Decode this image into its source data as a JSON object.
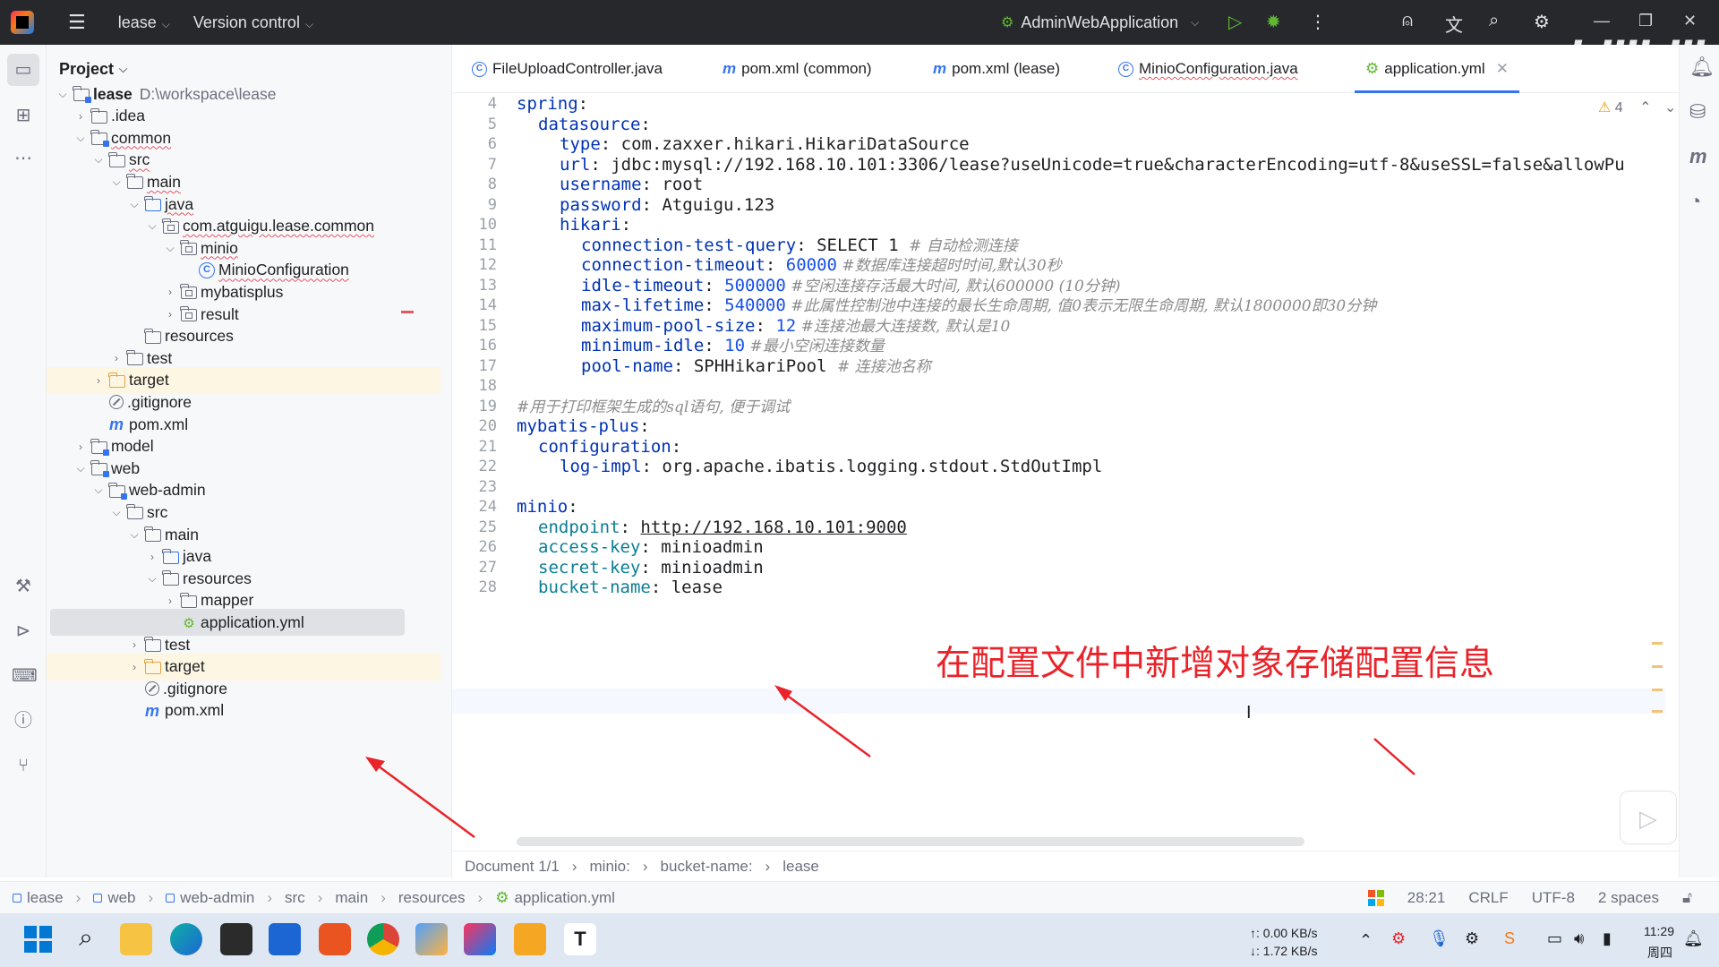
{
  "titlebar": {
    "project": "lease",
    "version_control": "Version control",
    "run_config": "AdminWebApplication"
  },
  "project_panel": {
    "title": "Project",
    "tree": [
      {
        "label": "lease",
        "path": "D:\\workspace\\lease"
      },
      {
        "label": ".idea"
      },
      {
        "label": "common"
      },
      {
        "label": "src"
      },
      {
        "label": "main"
      },
      {
        "label": "java"
      },
      {
        "label": "com.atguigu.lease.common"
      },
      {
        "label": "minio"
      },
      {
        "label": "MinioConfiguration"
      },
      {
        "label": "mybatisplus"
      },
      {
        "label": "result"
      },
      {
        "label": "resources"
      },
      {
        "label": "test"
      },
      {
        "label": "target"
      },
      {
        "label": ".gitignore"
      },
      {
        "label": "pom.xml"
      },
      {
        "label": "model"
      },
      {
        "label": "web"
      },
      {
        "label": "web-admin"
      },
      {
        "label": "src"
      },
      {
        "label": "main"
      },
      {
        "label": "java"
      },
      {
        "label": "resources"
      },
      {
        "label": "mapper"
      },
      {
        "label": "application.yml"
      },
      {
        "label": "test"
      },
      {
        "label": "target"
      },
      {
        "label": ".gitignore"
      },
      {
        "label": "pom.xml"
      }
    ]
  },
  "tabs": [
    {
      "label": "FileUploadController.java"
    },
    {
      "label": "pom.xml (common)"
    },
    {
      "label": "pom.xml (lease)"
    },
    {
      "label": "MinioConfiguration.java"
    },
    {
      "label": "application.yml"
    }
  ],
  "editor": {
    "warning_count": "4",
    "lines": [
      {
        "n": "4",
        "key": "spring",
        "rest": ":"
      },
      {
        "n": "5",
        "key": "datasource",
        "rest": ":"
      },
      {
        "n": "6",
        "key": "type",
        "rest": ": com.zaxxer.hikari.HikariDataSource"
      },
      {
        "n": "7",
        "key": "url",
        "rest": ": jdbc:mysql://192.168.10.101:3306/lease?useUnicode=true&characterEncoding=utf-8&useSSL=false&allowPu"
      },
      {
        "n": "8",
        "key": "username",
        "rest": ": root"
      },
      {
        "n": "9",
        "key": "password",
        "rest": ": Atguigu.123"
      },
      {
        "n": "10",
        "key": "hikari",
        "rest": ":"
      },
      {
        "n": "11",
        "key": "connection-test-query",
        "rest": ": SELECT 1 ",
        "comment": "# 自动检测连接"
      },
      {
        "n": "12",
        "key": "connection-timeout",
        "rest": ": ",
        "num": "60000",
        "comment": " #数据库连接超时时间,默认30秒"
      },
      {
        "n": "13",
        "key": "idle-timeout",
        "rest": ": ",
        "num": "500000",
        "comment": " #空闲连接存活最大时间, 默认600000 (10分钟)"
      },
      {
        "n": "14",
        "key": "max-lifetime",
        "rest": ": ",
        "num": "540000",
        "comment": " #此属性控制池中连接的最长生命周期, 值0表示无限生命周期, 默认1800000即30分钟"
      },
      {
        "n": "15",
        "key": "maximum-pool-size",
        "rest": ": ",
        "num": "12",
        "comment": " #连接池最大连接数, 默认是10"
      },
      {
        "n": "16",
        "key": "minimum-idle",
        "rest": ": ",
        "num": "10",
        "comment": " #最小空闲连接数量"
      },
      {
        "n": "17",
        "key": "pool-name",
        "rest": ": SPHHikariPool ",
        "comment": "# 连接池名称"
      },
      {
        "n": "18",
        "key": "",
        "rest": ""
      },
      {
        "n": "19",
        "key": "",
        "rest": "",
        "comment": "#用于打印框架生成的sql语句, 便于调试"
      },
      {
        "n": "20",
        "key": "mybatis-plus",
        "rest": ":"
      },
      {
        "n": "21",
        "key": "configuration",
        "rest": ":"
      },
      {
        "n": "22",
        "key": "log-impl",
        "rest": ": org.apache.ibatis.logging.stdout.StdOutImpl"
      },
      {
        "n": "23",
        "key": "",
        "rest": ""
      },
      {
        "n": "24",
        "key": "minio",
        "rest": ":"
      },
      {
        "n": "25",
        "key": "endpoint",
        "rest": ": ",
        "url": "http://192.168.10.101:9000"
      },
      {
        "n": "26",
        "key": "access-key",
        "rest": ": minioadmin"
      },
      {
        "n": "27",
        "key": "secret-key",
        "rest": ": minioadmin"
      },
      {
        "n": "28",
        "key": "bucket-name",
        "rest": ": lease"
      }
    ],
    "annotation": "在配置文件中新增对象存储配置信息",
    "breadcrumb": [
      "Document 1/1",
      "minio:",
      "bucket-name:",
      "lease"
    ]
  },
  "statusbar": {
    "crumbs": [
      "lease",
      "web",
      "web-admin",
      "src",
      "main",
      "resources",
      "application.yml"
    ],
    "position": "28:21",
    "line_sep": "CRLF",
    "encoding": "UTF-8",
    "indent": "2 spaces"
  },
  "taskbar": {
    "up_speed": "↑: 0.00 KB/s",
    "down_speed": "↓: 1.72 KB/s",
    "time": "11:29",
    "day": "周四"
  },
  "colors": {
    "accent": "#3574f0",
    "annotation": "#e8242a"
  }
}
